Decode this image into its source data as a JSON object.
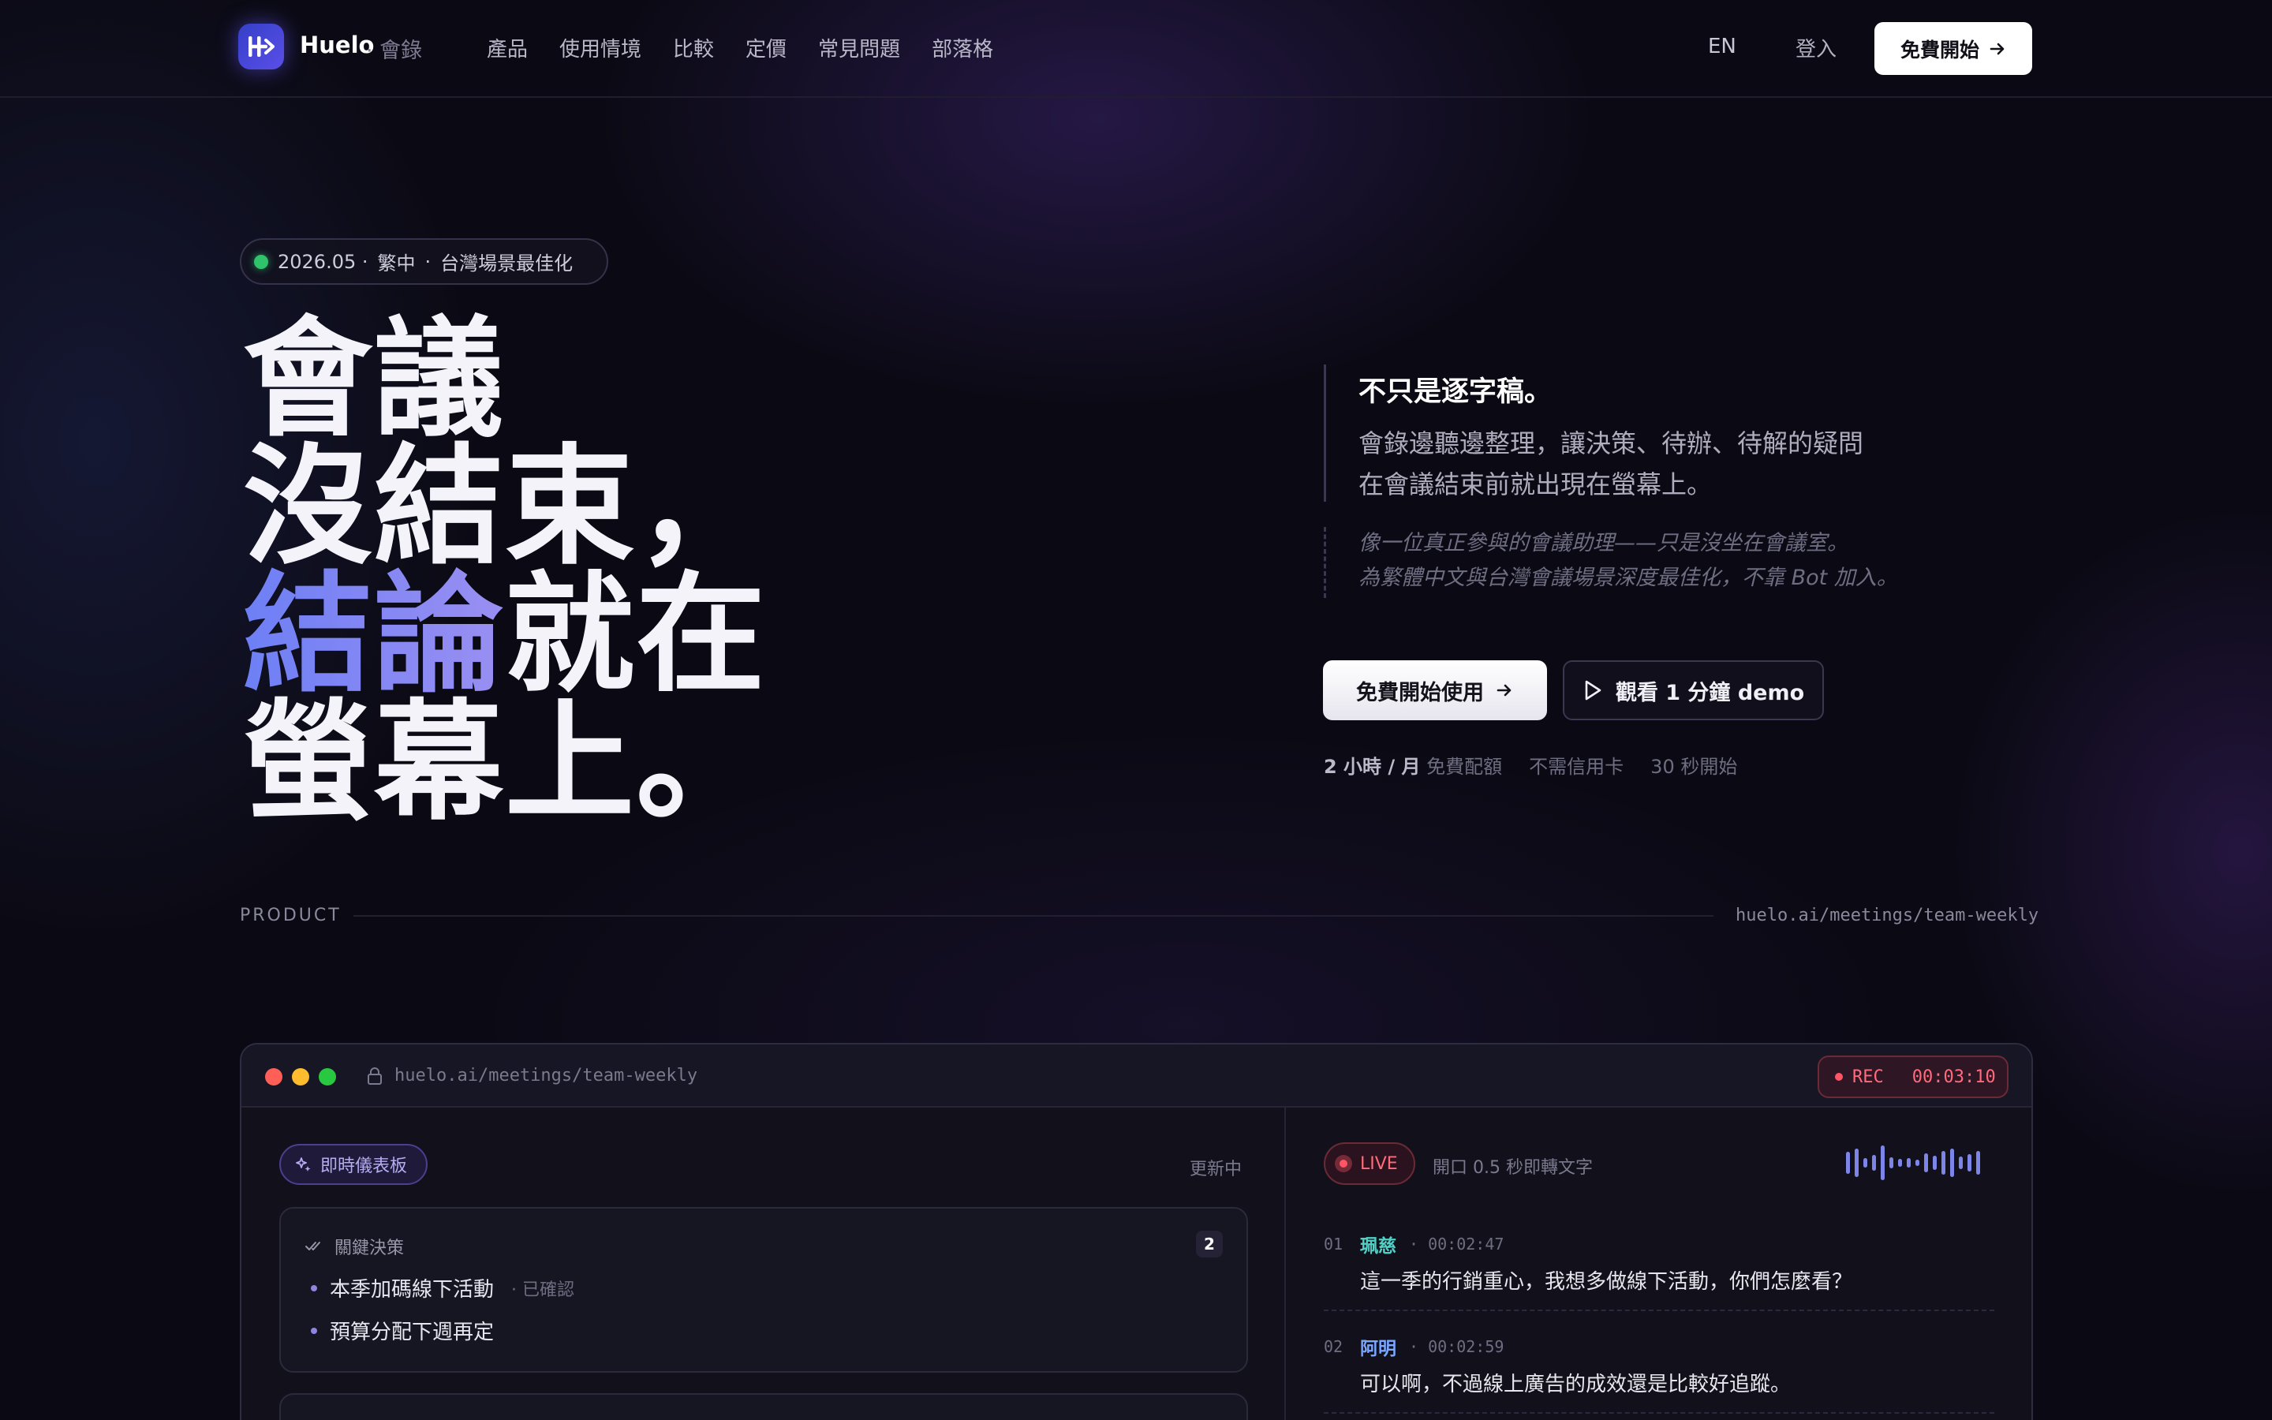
{
  "nav": {
    "brand": "Huelo",
    "brand_suffix": "· 會錄",
    "links": [
      "產品",
      "使用情境",
      "比較",
      "定價",
      "常見問題",
      "部落格"
    ],
    "lang": "EN",
    "login": "登入",
    "cta": "免費開始"
  },
  "badge": {
    "date": "2026.05 ·",
    "lang": "繁中",
    "sep": "·",
    "note": "台灣場景最佳化"
  },
  "hero": {
    "line1": "會議",
    "line2": "沒結束，",
    "line3_accent": "結論",
    "line3_rest": "就在",
    "line4": "螢幕上。"
  },
  "copy": {
    "title": "不只是逐字稿。",
    "body_line1": "會錄邊聽邊整理，讓決策、待辦、待解的疑問",
    "body_line2": "在會議結束前就出現在螢幕上。",
    "quote_line1": "像一位真正參與的會議助理——只是沒坐在會議室。",
    "quote_line2": "為繁體中文與台灣會議場景深度最佳化，不靠 Bot 加入。"
  },
  "buttons": {
    "primary": "免費開始使用",
    "secondary": "觀看 1 分鐘 demo"
  },
  "meta": {
    "quota_strong": "2 小時 / 月",
    "quota_rest": "免費配額",
    "no_card": "不需信用卡",
    "start": "30 秒開始"
  },
  "product": {
    "label": "PRODUCT",
    "url": "huelo.ai/meetings/team-weekly"
  },
  "window": {
    "url": "huelo.ai/meetings/team-weekly",
    "rec_label": "REC",
    "rec_time": "00:03:10",
    "dashboard_label": "即時儀表板",
    "updating": "更新中",
    "decisions": {
      "title": "關鍵決策",
      "count": "2",
      "items": [
        {
          "text": "本季加碼線下活動",
          "tag": "· 已確認"
        },
        {
          "text": "預算分配下週再定",
          "tag": ""
        }
      ]
    },
    "live_label": "LIVE",
    "live_note": "開口 0.5 秒即轉文字",
    "transcript": [
      {
        "num": "01",
        "speaker": "珮慈",
        "time": "· 00:02:47",
        "text": "這一季的行銷重心，我想多做線下活動，你們怎麼看？",
        "color": "#4fd1c5"
      },
      {
        "num": "02",
        "speaker": "阿明",
        "time": "· 00:02:59",
        "text": "可以啊，不過線上廣告的成效還是比較好追蹤。",
        "color": "#7aa7ff"
      }
    ]
  },
  "colors": {
    "accent": "#6d7ff5",
    "accent2": "#9a8ff2",
    "rec": "#ff5566",
    "live_dot": "#2fc46c"
  }
}
